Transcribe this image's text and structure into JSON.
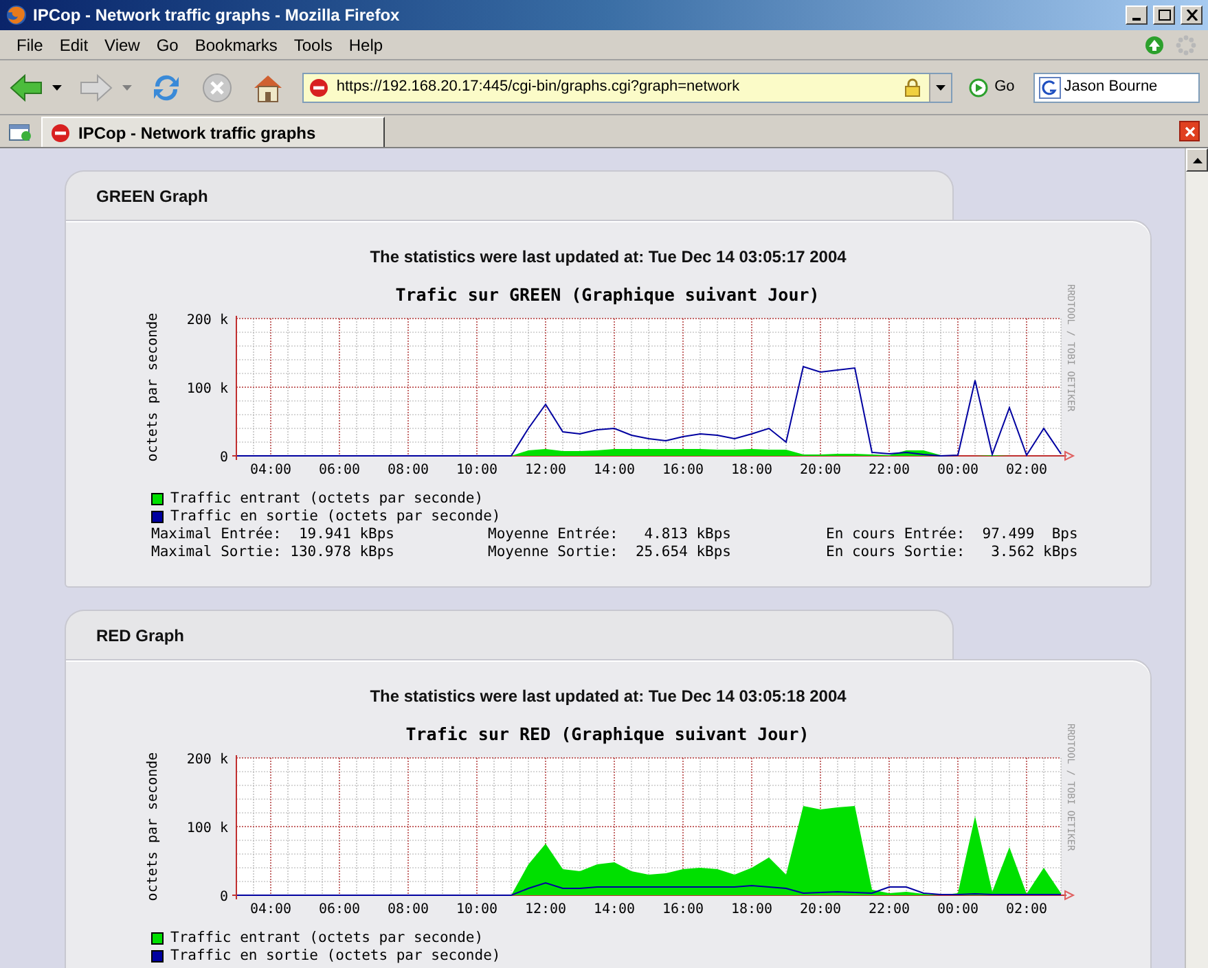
{
  "window": {
    "title": "IPCop - Network traffic graphs - Mozilla Firefox"
  },
  "menu": [
    {
      "label": "File"
    },
    {
      "label": "Edit"
    },
    {
      "label": "View"
    },
    {
      "label": "Go"
    },
    {
      "label": "Bookmarks"
    },
    {
      "label": "Tools"
    },
    {
      "label": "Help"
    }
  ],
  "toolbar": {
    "url": "https://192.168.20.17:445/cgi-bin/graphs.cgi?graph=network",
    "go_label": "Go",
    "search_value": "Jason Bourne"
  },
  "tabs": [
    {
      "label": "IPCop - Network traffic graphs",
      "selected": true
    }
  ],
  "panels": [
    {
      "title": "GREEN Graph",
      "updated": "The statistics were last updated at: Tue Dec 14 03:05:17 2004",
      "chart_data": {
        "type": "area",
        "grid": true,
        "title": "Trafic sur GREEN (Graphique suivant Jour)",
        "ylabel": "octets par seconde",
        "annotations": [
          "RRDTOOL / TOBI OETIKER"
        ],
        "categories": [
          null,
          null,
          "04:00",
          null,
          null,
          null,
          "06:00",
          null,
          null,
          null,
          "08:00",
          null,
          null,
          null,
          "10:00",
          null,
          null,
          null,
          "12:00",
          null,
          null,
          null,
          "14:00",
          null,
          null,
          null,
          "16:00",
          null,
          null,
          null,
          "18:00",
          null,
          null,
          null,
          "20:00",
          null,
          null,
          null,
          "22:00",
          null,
          null,
          null,
          "00:00",
          null,
          null,
          null,
          "02:00",
          null,
          null
        ],
        "ylim": [
          0,
          200
        ],
        "yticks": [
          {
            "value": 0,
            "label": "0"
          },
          {
            "value": 100,
            "label": "100 k"
          },
          {
            "value": 200,
            "label": "200 k"
          }
        ],
        "series": [
          {
            "name": "Traffic entrant (octets par seconde)",
            "type": "area",
            "color": "#00e000",
            "values": [
              0,
              0,
              0,
              0,
              0,
              0,
              0,
              0,
              0,
              0,
              0,
              0,
              0,
              0,
              0,
              0,
              0,
              8,
              10,
              7,
              7,
              8,
              10,
              10,
              10,
              10,
              10,
              10,
              9,
              9,
              10,
              9,
              9,
              2,
              2,
              3,
              3,
              2,
              1,
              8,
              8,
              1,
              0,
              0,
              1,
              0,
              0,
              0,
              0
            ]
          },
          {
            "name": "Traffic en sortie (octets par seconde)",
            "type": "line",
            "color": "#0000a0",
            "values": [
              0,
              0,
              0,
              0,
              0,
              0,
              0,
              0,
              0,
              0,
              0,
              0,
              0,
              0,
              0,
              0,
              0,
              40,
              75,
              35,
              32,
              38,
              40,
              30,
              25,
              22,
              28,
              32,
              30,
              25,
              32,
              40,
              20,
              130,
              122,
              125,
              128,
              5,
              3,
              5,
              2,
              0,
              1,
              110,
              2,
              70,
              1,
              40,
              3
            ]
          }
        ]
      },
      "stats": [
        [
          "Maximal Entrée:  19.941 kBps",
          "Moyenne Entrée:   4.813 kBps",
          "En cours Entrée:  97.499  Bps"
        ],
        [
          "Maximal Sortie: 130.978 kBps",
          "Moyenne Sortie:  25.654 kBps",
          "En cours Sortie:   3.562 kBps"
        ]
      ]
    },
    {
      "title": "RED Graph",
      "updated": "The statistics were last updated at: Tue Dec 14 03:05:18 2004",
      "chart_data": {
        "type": "area",
        "grid": true,
        "title": "Trafic sur RED (Graphique suivant Jour)",
        "ylabel": "octets par seconde",
        "annotations": [
          "RRDTOOL / TOBI OETIKER"
        ],
        "categories": [
          null,
          null,
          "04:00",
          null,
          null,
          null,
          "06:00",
          null,
          null,
          null,
          "08:00",
          null,
          null,
          null,
          "10:00",
          null,
          null,
          null,
          "12:00",
          null,
          null,
          null,
          "14:00",
          null,
          null,
          null,
          "16:00",
          null,
          null,
          null,
          "18:00",
          null,
          null,
          null,
          "20:00",
          null,
          null,
          null,
          "22:00",
          null,
          null,
          null,
          "00:00",
          null,
          null,
          null,
          "02:00",
          null,
          null
        ],
        "ylim": [
          0,
          200
        ],
        "yticks": [
          {
            "value": 0,
            "label": "0"
          },
          {
            "value": 100,
            "label": "100 k"
          },
          {
            "value": 200,
            "label": "200 k"
          }
        ],
        "series": [
          {
            "name": "Traffic entrant (octets par seconde)",
            "type": "area",
            "color": "#00e000",
            "values": [
              0,
              0,
              0,
              0,
              0,
              0,
              0,
              0,
              0,
              0,
              0,
              0,
              0,
              0,
              0,
              0,
              0,
              45,
              75,
              38,
              35,
              45,
              48,
              35,
              30,
              32,
              38,
              40,
              38,
              30,
              40,
              55,
              30,
              130,
              125,
              128,
              130,
              8,
              3,
              5,
              2,
              0,
              3,
              115,
              5,
              70,
              2,
              40,
              3
            ]
          },
          {
            "name": "Traffic en sortie (octets par seconde)",
            "type": "line",
            "color": "#0000a0",
            "values": [
              0,
              0,
              0,
              0,
              0,
              0,
              0,
              0,
              0,
              0,
              0,
              0,
              0,
              0,
              0,
              0,
              0,
              10,
              18,
              10,
              10,
              12,
              12,
              12,
              12,
              12,
              12,
              12,
              12,
              12,
              14,
              12,
              10,
              3,
              4,
              5,
              4,
              3,
              12,
              12,
              3,
              1,
              1,
              2,
              1,
              1,
              1,
              1,
              1
            ]
          }
        ]
      }
    }
  ]
}
